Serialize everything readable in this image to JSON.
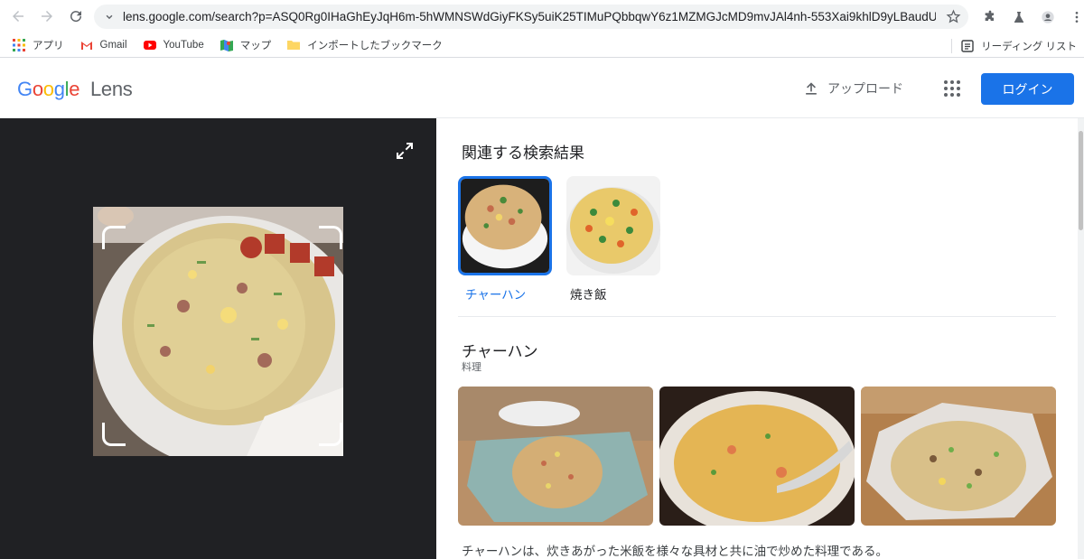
{
  "browser": {
    "url": "lens.google.com/search?p=ASQ0Rg0IHaGhEyJqH6m-5hWMNSWdGiyFKSy5uiK25TIMuPQbbqwY6z1MZMGJcMD9mvJAl4nh-553Xai9khlD9yLBaudUa...",
    "bookmarks": [
      "アプリ",
      "Gmail",
      "YouTube",
      "マップ",
      "インポートしたブックマーク"
    ],
    "reading_list": "リーディング リスト"
  },
  "header": {
    "logo_google": "Google",
    "logo_lens": "Lens",
    "upload_label": "アップロード",
    "login_label": "ログイン"
  },
  "results": {
    "related_title": "関連する検索結果",
    "related": [
      {
        "label": "チャーハン",
        "selected": true
      },
      {
        "label": "焼き飯",
        "selected": false
      }
    ],
    "entity_title": "チャーハン",
    "entity_subtitle": "料理",
    "description": "チャーハンは、炊きあがった米飯を様々な具材と共に油で炒めた料理である。"
  },
  "colors": {
    "accent": "#1a73e8",
    "dark_pane": "#202124",
    "link": "#1a73e8"
  }
}
